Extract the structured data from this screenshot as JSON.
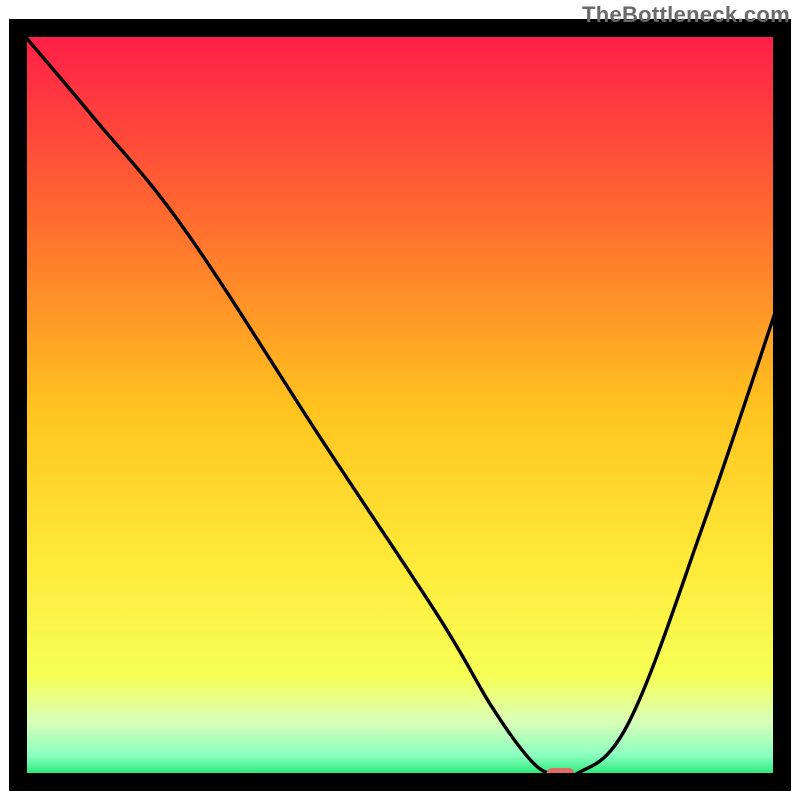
{
  "watermark": "TheBottleneck.com",
  "chart_data": {
    "type": "line",
    "title": "",
    "xlabel": "",
    "ylabel": "",
    "xlim": [
      0,
      100
    ],
    "ylim": [
      0,
      100
    ],
    "grid": false,
    "legend": false,
    "background_gradient": {
      "top": "#ff1b4a",
      "upper_mid": "#ff8a2d",
      "mid": "#ffd423",
      "lower_mid": "#f6ff56",
      "bottom": "#00e05a"
    },
    "series": [
      {
        "name": "bottleneck-curve",
        "color": "#000000",
        "x": [
          0,
          10,
          22,
          40,
          55,
          62,
          67,
          70,
          73,
          80,
          90,
          100
        ],
        "y": [
          100,
          88,
          73,
          45,
          22,
          10,
          3,
          1,
          1,
          8,
          35,
          65
        ]
      }
    ],
    "marker": {
      "name": "selected-point",
      "x": 71,
      "y": 1,
      "color": "#e06a6a",
      "shape": "rounded-rect"
    }
  }
}
